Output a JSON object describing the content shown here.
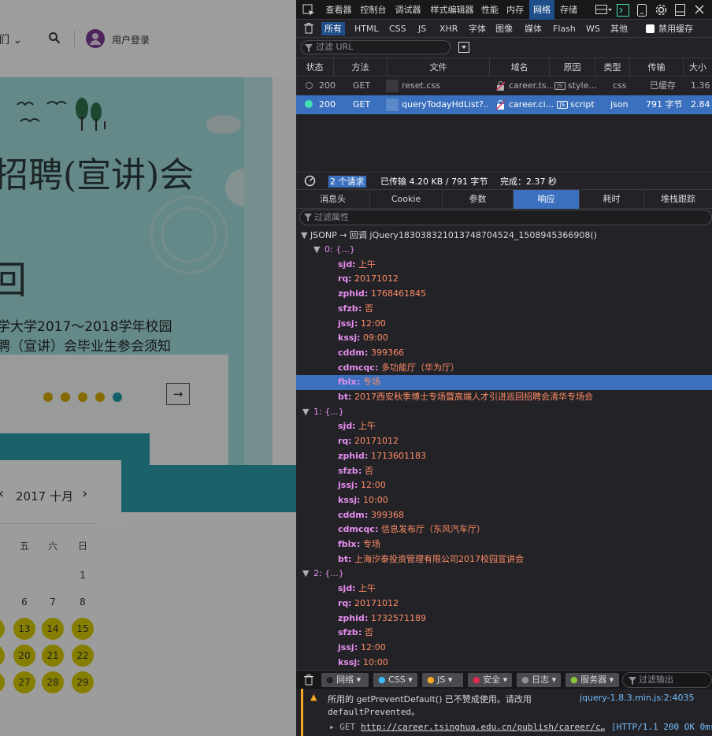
{
  "left_page": {
    "nav_partial": "们 ⌄",
    "login_label": "用户登录",
    "banner_title": "招聘(宣讲)会",
    "banner_hui": "回",
    "card_line1": "学大学2017～2018学年校园",
    "card_line2": "聘（宣讲）会毕业生参会须知",
    "next_arrow": "→",
    "calendar": {
      "prev": "‹",
      "title": "2017 十月",
      "next": "›",
      "weekdays": [
        "五",
        "六",
        "日"
      ],
      "rows": [
        [
          "",
          "",
          "1"
        ],
        [
          "6",
          "7",
          "8"
        ],
        [
          "13",
          "14",
          "15"
        ],
        [
          "20",
          "21",
          "22"
        ],
        [
          "27",
          "28",
          "29"
        ]
      ],
      "partial_circles": 3
    }
  },
  "devtools": {
    "toolbar_tabs": [
      "查看器",
      "控制台",
      "调试器",
      "样式编辑器",
      "性能",
      "内存",
      "网络",
      "存储"
    ],
    "selected_tab": "网络",
    "filter_buttons": [
      "所有",
      "HTML",
      "CSS",
      "JS",
      "XHR",
      "字体",
      "图像",
      "媒体",
      "Flash",
      "WS",
      "其他"
    ],
    "selected_filter": "所有",
    "disable_cache_label": "禁用缓存",
    "url_filter_placeholder": "过滤 URL",
    "columns": [
      "状态",
      "方法",
      "文件",
      "域名",
      "原因",
      "类型",
      "传输",
      "大小"
    ],
    "requests": [
      {
        "status": "200",
        "method": "GET",
        "file": "reset.css",
        "domain": "career.ts...",
        "cause": "style...",
        "cause_badge": "JS",
        "type": "css",
        "transfer": "已缓存",
        "size": "1.36"
      },
      {
        "status": "200",
        "method": "GET",
        "file": "queryTodayHdList?...",
        "domain": "career.ci...",
        "cause": "script",
        "cause_badge": "JS",
        "type": "json",
        "transfer": "791 字节",
        "size": "2.84"
      }
    ],
    "summary": {
      "count": "2 个请求",
      "transferred": "已传输 4.20 KB / 791 字节",
      "finish": "完成：2.37 秒"
    },
    "detail_tabs": [
      "消息头",
      "Cookie",
      "参数",
      "响应",
      "耗时",
      "堆栈跟踪"
    ],
    "selected_detail_tab": "响应",
    "prop_filter_placeholder": "过滤属性",
    "jsonp_line": "JSONP → 回调 jQuery183038321013748704524_1508945366908()",
    "items": [
      {
        "index": "0: {...}",
        "fields": [
          {
            "k": "sjd",
            "v": "上午"
          },
          {
            "k": "rq",
            "v": "20171012"
          },
          {
            "k": "zphid",
            "v": "1768461845"
          },
          {
            "k": "sfzb",
            "v": "否"
          },
          {
            "k": "jssj",
            "v": "12:00"
          },
          {
            "k": "kssj",
            "v": "09:00"
          },
          {
            "k": "cddm",
            "v": "399366"
          },
          {
            "k": "cdmcqc",
            "v": "多功能厅（华为厅）"
          },
          {
            "k": "fblx",
            "v": "专场"
          },
          {
            "k": "bt",
            "v": "2017西安秋季博士专场暨高端人才引进巡回招聘会清华专场会"
          }
        ]
      },
      {
        "index": "1: {...}",
        "fields": [
          {
            "k": "sjd",
            "v": "上午"
          },
          {
            "k": "rq",
            "v": "20171012"
          },
          {
            "k": "zphid",
            "v": "1713601183"
          },
          {
            "k": "sfzb",
            "v": "否"
          },
          {
            "k": "jssj",
            "v": "12:00"
          },
          {
            "k": "kssj",
            "v": "10:00"
          },
          {
            "k": "cddm",
            "v": "399368"
          },
          {
            "k": "cdmcqc",
            "v": "信息发布厅（东风汽车厅）"
          },
          {
            "k": "fblx",
            "v": "专场"
          },
          {
            "k": "bt",
            "v": "上海汐泰投资管理有限公司2017校园宣讲会"
          }
        ]
      },
      {
        "index": "2: {...}",
        "fields": [
          {
            "k": "sjd",
            "v": "上午"
          },
          {
            "k": "rq",
            "v": "20171012"
          },
          {
            "k": "zphid",
            "v": "1732571189"
          },
          {
            "k": "sfzb",
            "v": "否"
          },
          {
            "k": "jssj",
            "v": "12:00"
          },
          {
            "k": "kssj",
            "v": "10:00"
          }
        ]
      }
    ],
    "console_tabs": [
      "网络",
      "CSS",
      "JS",
      "安全",
      "日志",
      "服务器"
    ],
    "console_filter_placeholder": "过滤输出",
    "warning_text_1": "所用的 getPreventDefault() 已不赞成使用。请改用",
    "warning_source": "jquery-1.8.3.min.js:2:4035",
    "warning_text_2": "defaultPrevented。",
    "get_prefix": "▸ GET",
    "get_url": "http://career.tsinghua.edu.cn/publish/career/c…",
    "get_status": "[HTTP/1.1 200 OK 0ms]",
    "colors": {
      "accent": "#3a70bd",
      "key": "#e78ef0",
      "value": "#ff8b66",
      "bg": "#232327"
    }
  }
}
